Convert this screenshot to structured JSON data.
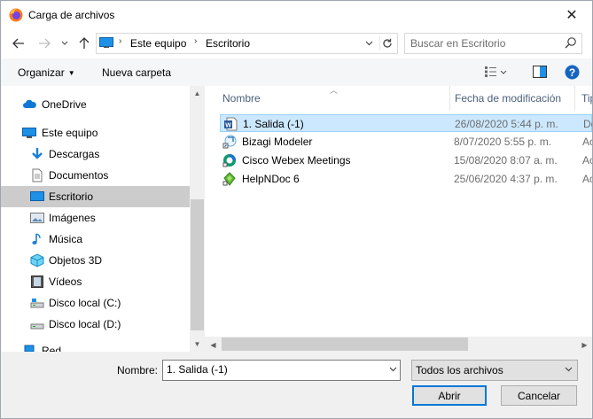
{
  "window": {
    "title": "Carga de archivos",
    "close_glyph": "✕"
  },
  "nav": {
    "back_icon": "arrow-left-icon",
    "forward_icon": "arrow-right-icon",
    "recent_icon": "chevron-down-icon",
    "up_icon": "arrow-up-icon",
    "breadcrumb": [
      "Este equipo",
      "Escritorio"
    ],
    "refresh_icon": "refresh-icon",
    "search_placeholder": "Buscar en Escritorio"
  },
  "toolbar": {
    "organize": "Organizar",
    "new_folder": "Nueva carpeta"
  },
  "sidebar": {
    "items": [
      {
        "label": "OneDrive",
        "icon": "cloud-icon",
        "selected": false
      },
      {
        "label": "Este equipo",
        "icon": "computer-icon",
        "selected": false
      },
      {
        "label": "Descargas",
        "icon": "download-icon",
        "selected": false
      },
      {
        "label": "Documentos",
        "icon": "document-icon",
        "selected": false
      },
      {
        "label": "Escritorio",
        "icon": "desktop-icon",
        "selected": true
      },
      {
        "label": "Imágenes",
        "icon": "image-icon",
        "selected": false
      },
      {
        "label": "Música",
        "icon": "music-icon",
        "selected": false
      },
      {
        "label": "Objetos 3D",
        "icon": "cube-icon",
        "selected": false
      },
      {
        "label": "Vídeos",
        "icon": "video-icon",
        "selected": false
      },
      {
        "label": "Disco local (C:)",
        "icon": "drive-icon",
        "selected": false
      },
      {
        "label": "Disco local (D:)",
        "icon": "drive-icon",
        "selected": false
      },
      {
        "label": "Red",
        "icon": "network-icon",
        "selected": false
      }
    ]
  },
  "files": {
    "columns": {
      "name": "Nombre",
      "modified": "Fecha de modificación",
      "type": "Tip"
    },
    "rows": [
      {
        "name": "1. Salida (-1)",
        "modified": "26/08/2020 5:44 p. m.",
        "type": "Do",
        "icon": "word-doc-icon",
        "selected": true
      },
      {
        "name": "Bizagi Modeler",
        "modified": "8/07/2020 5:55 p. m.",
        "type": "Ac",
        "icon": "shortcut-icon",
        "selected": false
      },
      {
        "name": "Cisco Webex Meetings",
        "modified": "15/08/2020 8:07 a. m.",
        "type": "Ac",
        "icon": "webex-icon",
        "selected": false
      },
      {
        "name": "HelpNDoc 6",
        "modified": "25/06/2020 4:37 p. m.",
        "type": "Ac",
        "icon": "helpndoc-icon",
        "selected": false
      }
    ]
  },
  "footer": {
    "name_label": "Nombre:",
    "name_value": "1. Salida (-1)",
    "filter_value": "Todos los archivos",
    "open_button": "Abrir",
    "cancel_button": "Cancelar"
  },
  "colors": {
    "accent": "#0078d7",
    "selection": "#cce8ff",
    "sidebar_selection": "#cccccc"
  }
}
